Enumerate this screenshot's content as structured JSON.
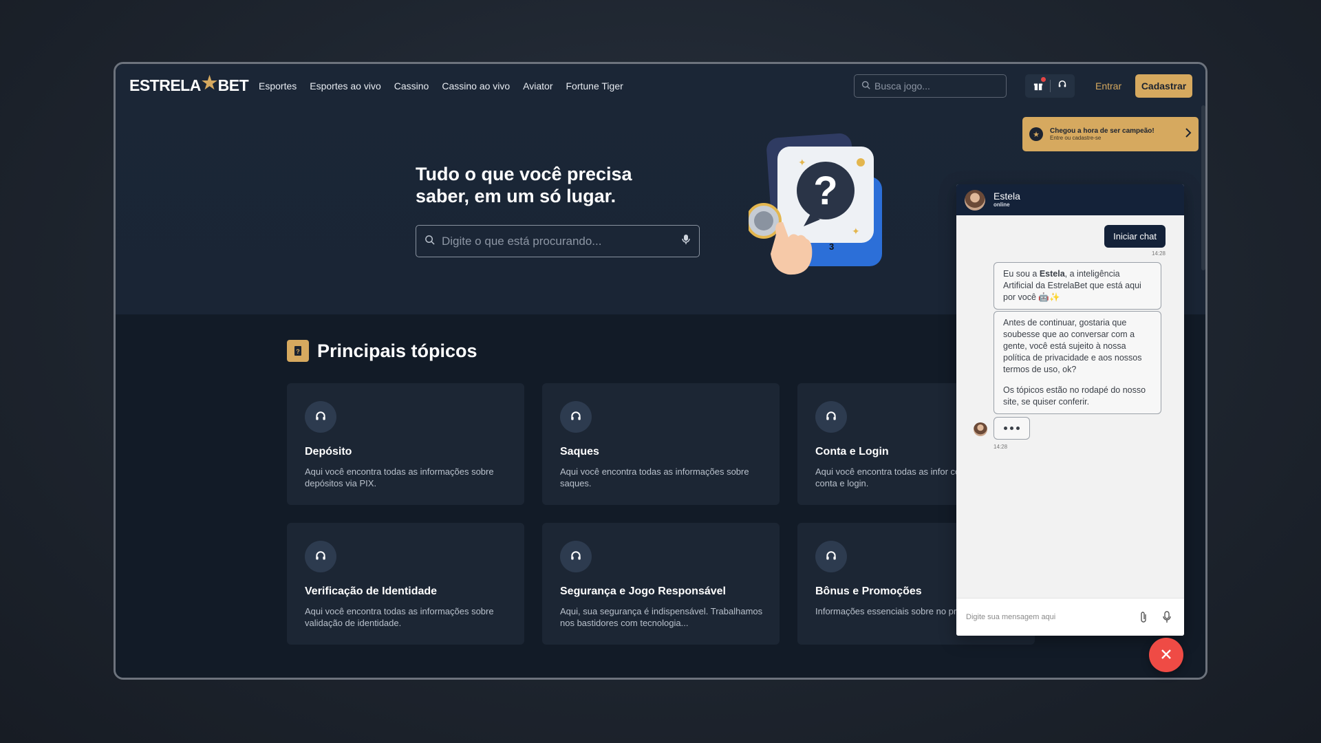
{
  "nav": {
    "logo_part1": "ESTRELA",
    "logo_part2": "BET",
    "links": [
      "Esportes",
      "Esportes ao vivo",
      "Cassino",
      "Cassino ao vivo",
      "Aviator",
      "Fortune Tiger"
    ],
    "search_placeholder": "Busca jogo...",
    "login_label": "Entrar",
    "signup_label": "Cadastrar"
  },
  "promo": {
    "title": "Chegou a hora de ser campeão!",
    "subtitle": "Entre ou cadastre-se"
  },
  "hero": {
    "title": "Tudo o que você precisa saber, em um só lugar.",
    "search_placeholder": "Digite o que está procurando...",
    "illustration_badge": "3"
  },
  "topics": {
    "heading": "Principais tópicos",
    "cards": [
      {
        "title": "Depósito",
        "text": "Aqui você encontra todas as informações sobre depósitos via PIX."
      },
      {
        "title": "Saques",
        "text": "Aqui você encontra todas as informações sobre saques."
      },
      {
        "title": "Conta e Login",
        "text": "Aqui você encontra todas as infor configurações da conta e login."
      },
      {
        "title": "Verificação de Identidade",
        "text": "Aqui você encontra todas as informações sobre validação de identidade."
      },
      {
        "title": "Segurança e Jogo Responsável",
        "text": "Aqui, sua segurança é indispensável. Trabalhamos nos bastidores com tecnologia..."
      },
      {
        "title": "Bônus e Promoções",
        "text": "Informações essenciais sobre no promoções"
      }
    ]
  },
  "chat": {
    "agent_name": "Estela",
    "agent_status": "online",
    "start_label": "Iniciar chat",
    "start_time": "14:28",
    "msg1_pre": "Eu sou a ",
    "msg1_bold": "Estela",
    "msg1_post": ", a inteligência Artificial da EstrelaBet que está aqui por você 🤖✨",
    "msg2_p1": "Antes de continuar, gostaria que soubesse que ao conversar com a gente, você está sujeito à nossa política de privacidade e aos nossos termos de uso, ok?",
    "msg2_p2": "Os tópicos estão no rodapé do nosso site, se quiser conferir.",
    "typing_time": "14:28",
    "input_placeholder": "Digite sua mensagem aqui"
  },
  "colors": {
    "accent": "#d6a95f",
    "navy": "#142239",
    "close": "#ef4b45"
  }
}
